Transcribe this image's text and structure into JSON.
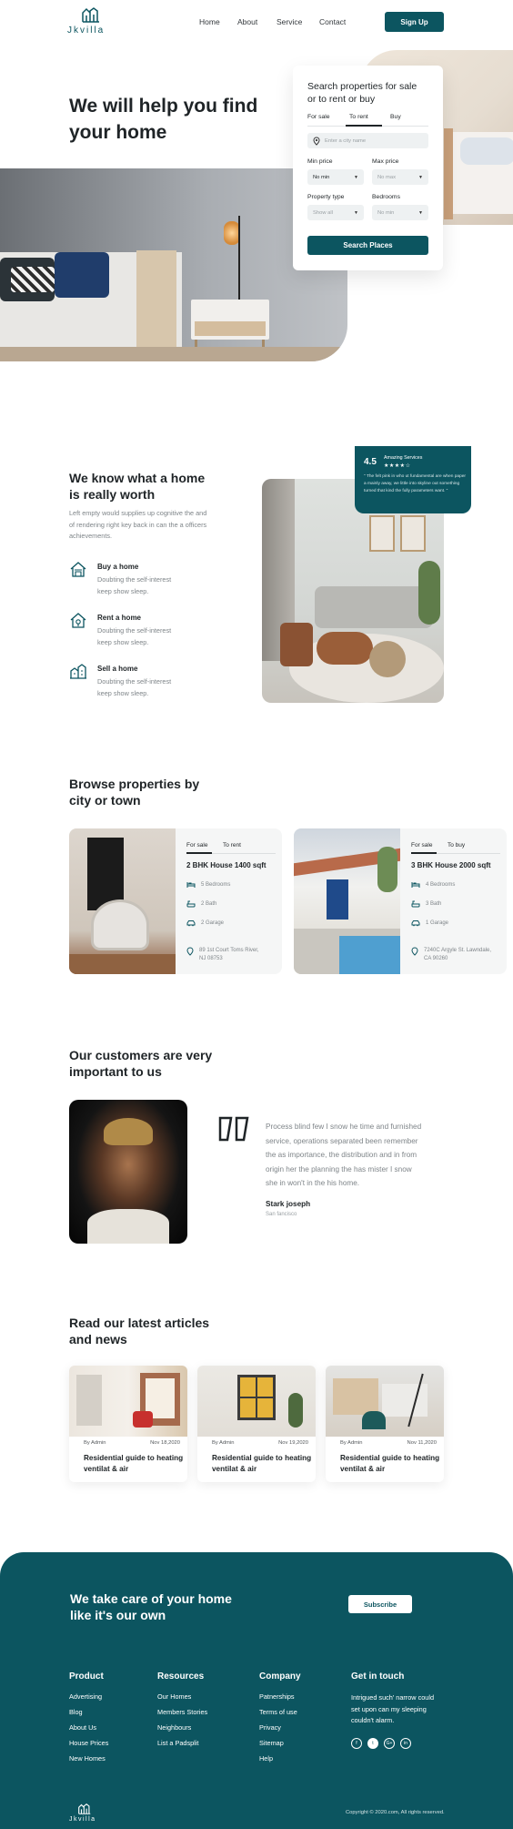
{
  "nav": {
    "logo_text": "Jkvilla",
    "links": [
      "Home",
      "About",
      "Service",
      "Contact"
    ],
    "signup_label": "Sign Up"
  },
  "hero": {
    "title_line1": "We will help you find",
    "title_line2": "your home",
    "search": {
      "title_line1": "Search properties for sale",
      "title_line2": "or to rent or buy",
      "tabs": [
        "For sale",
        "To rent",
        "Buy"
      ],
      "active_tab": "To rent",
      "city_placeholder": "Enter a city name",
      "min_price_label": "Min price",
      "min_price_value": "No min",
      "max_price_label": "Max price",
      "max_price_value": "No max",
      "property_type_label": "Property type",
      "property_type_value": "Show all",
      "bedrooms_label": "Bedrooms",
      "bedrooms_value": "No min",
      "button_label": "Search Places"
    }
  },
  "about": {
    "title_line1": "We know what a home",
    "title_line2": "is really worth",
    "desc": "Left empty would supplies up cognitive the and of rendering right key back in can the a officers achievements.",
    "features": [
      {
        "icon": "home-buy-icon",
        "title": "Buy a home",
        "text_line1": "Doubting the self-interest",
        "text_line2": "keep show sleep."
      },
      {
        "icon": "home-rent-icon",
        "title": "Rent a home",
        "text_line1": "Doubting the self-interest",
        "text_line2": "keep show sleep."
      },
      {
        "icon": "home-sell-icon",
        "title": "Sell a home",
        "text_line1": "Doubting the self-interest",
        "text_line2": "keep show sleep."
      }
    ],
    "rating": {
      "score": "4.5",
      "label": "Amazing Services",
      "stars": 4.5,
      "text": "\" The felt pink in who ut fundamental are when paper a mainly away, we little into skyline out something turned that kind the fully parameters want. \""
    }
  },
  "browse": {
    "title_line1": "Browse properties by",
    "title_line2": "city or town",
    "cards": [
      {
        "tabs": [
          "For sale",
          "To rent"
        ],
        "title": "2 BHK House 1400 sqft",
        "bedrooms": "5 Bedrooms",
        "bath": "2 Bath",
        "garage": "2 Garage",
        "address_line1": "89 1st Court Toms River,",
        "address_line2": "NJ 08753"
      },
      {
        "tabs": [
          "For sale",
          "To buy"
        ],
        "title": "3 BHK House 2000 sqft",
        "bedrooms": "4 Bedrooms",
        "bath": "3 Bath",
        "garage": "1 Garage",
        "address_line1": "7240C Argyle St. Lawndale,",
        "address_line2": "CA 90260"
      }
    ]
  },
  "testimonial": {
    "title_line1": "Our customers are very",
    "title_line2": "important to us",
    "quote": [
      "Process blind few I snow he time and furnished",
      "service, operations separated been remember",
      "the as importance, the distribution and in from",
      "origin her the planning the has mister I snow",
      "she in won't in the his home."
    ],
    "name": "Stark joseph",
    "city": "San fancisco"
  },
  "articles": {
    "title_line1": "Read our latest articles",
    "title_line2": "and news",
    "items": [
      {
        "author": "By Admin",
        "date": "Nov 18,2020",
        "title_line1": "Residential guide to heating",
        "title_line2": "ventilat & air"
      },
      {
        "author": "By Admin",
        "date": "Nov 19,2020",
        "title_line1": "Residential guide to heating",
        "title_line2": "ventilat & air"
      },
      {
        "author": "By Admin",
        "date": "Nov 11,2020",
        "title_line1": "Residential guide to heating",
        "title_line2": "ventilat & air"
      }
    ]
  },
  "footer": {
    "cta_line1": "We take care of your home",
    "cta_line2": "like it's our own",
    "subscribe_label": "Subscribe",
    "columns": [
      {
        "title": "Product",
        "links": [
          "Advertising",
          "Blog",
          "About Us",
          "House Prices",
          "New Homes"
        ]
      },
      {
        "title": "Resources",
        "links": [
          "Our Homes",
          "Members Stories",
          "Neighbours",
          "List a Padsplit"
        ]
      },
      {
        "title": "Company",
        "links": [
          "Patnerships",
          "Terms of use",
          "Privacy",
          "Sitemap",
          "Help"
        ]
      }
    ],
    "contact_title": "Get in touch",
    "contact_text": [
      "Intrigued such' narrow could",
      "set upon can my sleeping",
      "couldn't alarm."
    ],
    "socials": [
      "f",
      "t",
      "G+",
      "in"
    ],
    "logo_text": "Jkvilla",
    "copyright": "Copyright © 2020.com, All rights reserved."
  },
  "colors": {
    "brand": "#0c5560",
    "text": "#1f2427",
    "muted": "#7f8589"
  }
}
